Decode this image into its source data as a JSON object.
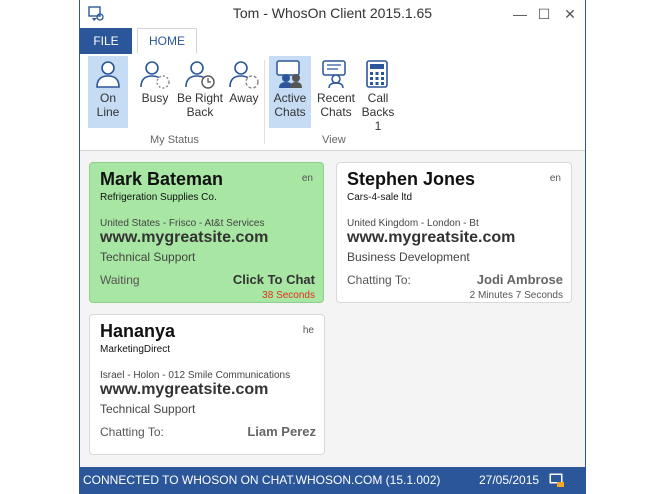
{
  "window": {
    "title": "Tom - WhosOn Client 2015.1.65",
    "minimize": "—",
    "maximize": "☐",
    "close": "✕"
  },
  "tabs": {
    "file": "FILE",
    "home": "HOME"
  },
  "ribbon": {
    "status_buttons": [
      {
        "line1": "On",
        "line2": "Line"
      },
      {
        "line1": "Busy",
        "line2": ""
      },
      {
        "line1": "Be Right",
        "line2": "Back"
      },
      {
        "line1": "Away",
        "line2": ""
      }
    ],
    "status_group": "My Status",
    "view_buttons": [
      {
        "line1": "Active",
        "line2": "Chats"
      },
      {
        "line1": "Recent",
        "line2": "Chats"
      },
      {
        "line1": "Call",
        "line2": "Backs 1"
      }
    ],
    "view_group": "View"
  },
  "chats": [
    {
      "name": "Mark Bateman",
      "company": "Refrigeration Supplies Co.",
      "lang": "en",
      "location": "United States - Frisco - At&t Services",
      "site": "www.mygreatsite.com",
      "department": "Technical Support",
      "state": "Waiting",
      "who": "Click To Chat",
      "time": "38 Seconds",
      "waiting": true
    },
    {
      "name": "Stephen Jones",
      "company": "Cars-4-sale ltd",
      "lang": "en",
      "location": "United Kingdom - London  - Bt",
      "site": "www.mygreatsite.com",
      "department": "Business Development",
      "state": "Chatting To:",
      "who": "Jodi Ambrose",
      "time": "2 Minutes 7 Seconds",
      "waiting": false
    },
    {
      "name": "Hananya",
      "company": "MarketingDirect",
      "lang": "he",
      "location": "Israel - Holon - 012 Smile Communications",
      "site": "www.mygreatsite.com",
      "department": "Technical Support",
      "state": "Chatting To:",
      "who": "Liam Perez",
      "time": "",
      "waiting": false
    }
  ],
  "statusbar": {
    "text": "CONNECTED TO WHOSON ON CHAT.WHOSON.COM (15.1.002)",
    "date": "27/05/2015"
  },
  "colors": {
    "accent": "#2b579a",
    "waiting_card": "#a8e6a3",
    "selected_button": "#c5dcf4",
    "timer_red": "#e0301e"
  }
}
